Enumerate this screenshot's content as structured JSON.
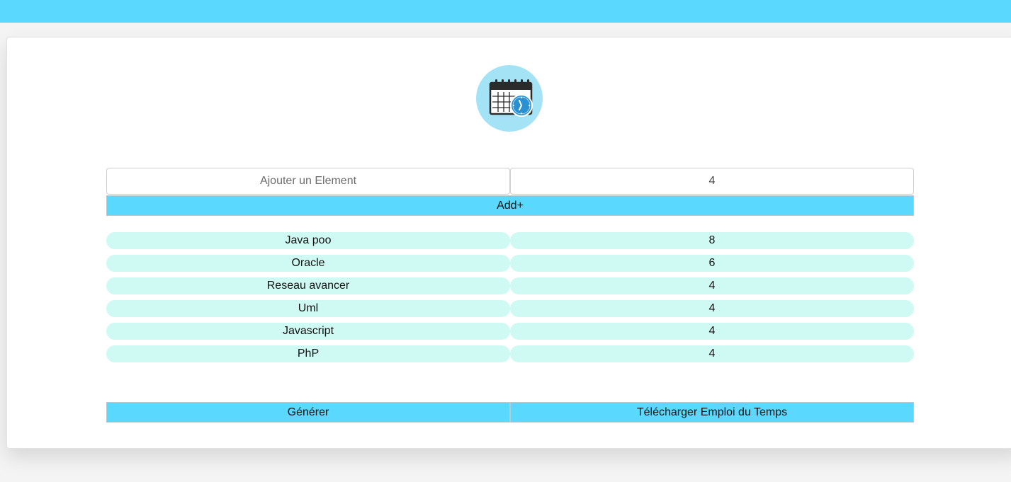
{
  "colors": {
    "accent": "#5ad8fd",
    "pill_background": "#cffaf4",
    "logo_background": "#a4e2f6"
  },
  "logo": {
    "icon": "calendar-clock-icon"
  },
  "form": {
    "element_placeholder": "Ajouter un Element",
    "hours_value": "4",
    "add_label": "Add+"
  },
  "items": [
    {
      "name": "Java poo",
      "hours": "8"
    },
    {
      "name": "Oracle",
      "hours": "6"
    },
    {
      "name": "Reseau avancer",
      "hours": "4"
    },
    {
      "name": "Uml",
      "hours": "4"
    },
    {
      "name": "Javascript",
      "hours": "4"
    },
    {
      "name": "PhP",
      "hours": "4"
    }
  ],
  "actions": {
    "generate_label": "Générer",
    "download_label": "Télécharger Emploi du Temps"
  }
}
